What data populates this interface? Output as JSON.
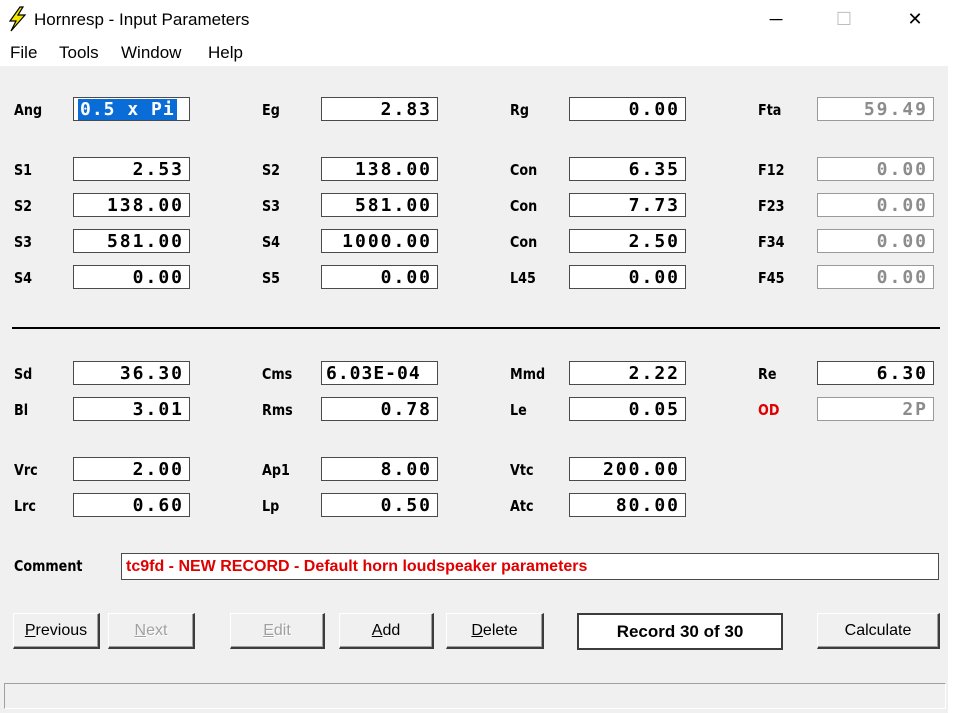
{
  "window": {
    "title": "Hornresp - Input Parameters",
    "controls": {
      "minimize": "─",
      "maximize": "☐",
      "close": "✕"
    }
  },
  "menu": [
    "File",
    "Tools",
    "Window",
    "Help"
  ],
  "horn": {
    "ang": {
      "label": "Ang",
      "value": "0.5 x Pi"
    },
    "eg": {
      "label": "Eg",
      "value": "2.83"
    },
    "rg": {
      "label": "Rg",
      "value": "0.00"
    },
    "fta": {
      "label": "Fta",
      "value": "59.49"
    },
    "rows": [
      [
        {
          "label": "S1",
          "value": "2.53"
        },
        {
          "label": "S2",
          "value": "138.00"
        },
        {
          "label": "Con",
          "value": "6.35"
        },
        {
          "label": "F12",
          "value": "0.00"
        }
      ],
      [
        {
          "label": "S2",
          "value": "138.00"
        },
        {
          "label": "S3",
          "value": "581.00"
        },
        {
          "label": "Con",
          "value": "7.73"
        },
        {
          "label": "F23",
          "value": "0.00"
        }
      ],
      [
        {
          "label": "S3",
          "value": "581.00"
        },
        {
          "label": "S4",
          "value": "1000.00"
        },
        {
          "label": "Con",
          "value": "2.50"
        },
        {
          "label": "F34",
          "value": "0.00"
        }
      ],
      [
        {
          "label": "S4",
          "value": "0.00"
        },
        {
          "label": "S5",
          "value": "0.00"
        },
        {
          "label": "L45",
          "value": "0.00"
        },
        {
          "label": "F45",
          "value": "0.00"
        }
      ]
    ]
  },
  "driver": {
    "rows": [
      [
        {
          "label": "Sd",
          "value": "36.30"
        },
        {
          "label": "Cms",
          "value": "6.03E-04"
        },
        {
          "label": "Mmd",
          "value": "2.22"
        },
        {
          "label": "Re",
          "value": "6.30"
        }
      ],
      [
        {
          "label": "Bl",
          "value": "3.01"
        },
        {
          "label": "Rms",
          "value": "0.78"
        },
        {
          "label": "Le",
          "value": "0.05"
        },
        {
          "label": "OD",
          "value": "2P"
        }
      ]
    ]
  },
  "chamber": {
    "rows": [
      [
        {
          "label": "Vrc",
          "value": "2.00"
        },
        {
          "label": "Ap1",
          "value": "8.00"
        },
        {
          "label": "Vtc",
          "value": "200.00"
        }
      ],
      [
        {
          "label": "Lrc",
          "value": "0.60"
        },
        {
          "label": "Lp",
          "value": "0.50"
        },
        {
          "label": "Atc",
          "value": "80.00"
        }
      ]
    ]
  },
  "comment": {
    "label": "Comment",
    "value": "tc9fd - NEW RECORD - Default horn loudspeaker parameters"
  },
  "buttons": {
    "previous": {
      "key": "P",
      "rest": "revious"
    },
    "next": {
      "key": "N",
      "rest": "ext"
    },
    "edit": {
      "key": "E",
      "rest": "dit"
    },
    "add": {
      "key": "A",
      "rest": "dd"
    },
    "delete": {
      "key": "D",
      "rest": "elete"
    },
    "calculate": "Calculate"
  },
  "record": "Record 30 of 30",
  "colors": {
    "accent_red": "#e00000",
    "selection": "#0a6cd6"
  }
}
